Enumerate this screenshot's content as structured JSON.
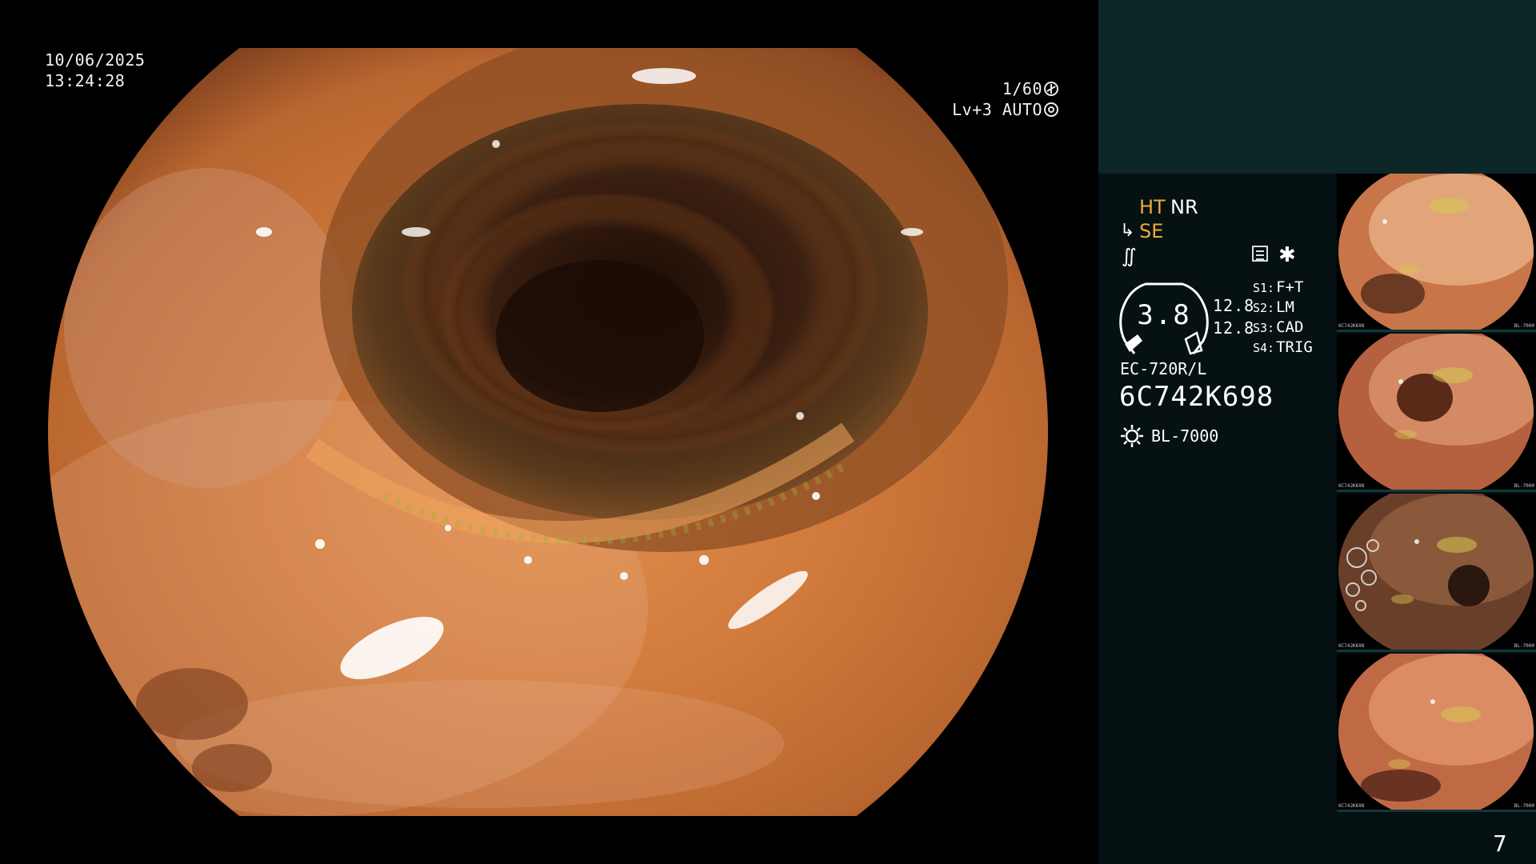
{
  "overlay": {
    "date": "10/06/2025",
    "time": "13:24:28",
    "shutter_speed": "1/60",
    "iris_level": "Lv+3 AUTO"
  },
  "modes": {
    "ht": "HT",
    "nr": "NR",
    "se": "SE"
  },
  "zoom": {
    "value": "3.8",
    "param_1": "12.8",
    "param_2": "12.8"
  },
  "switches": [
    {
      "key": "S1:",
      "value": "F+T"
    },
    {
      "key": "S2:",
      "value": "LM"
    },
    {
      "key": "S3:",
      "value": "CAD"
    },
    {
      "key": "S4:",
      "value": "TRIG"
    }
  ],
  "scope": {
    "model": "EC-720R/L",
    "serial": "6C742K698",
    "light_source": "BL-7000"
  },
  "thumbnails": [
    {
      "serial": "6C742K698",
      "light": "BL-7000",
      "palette": [
        "#f4c59a",
        "#c8754a",
        "#6b3a22"
      ]
    },
    {
      "serial": "6C742K698",
      "light": "BL-7000",
      "palette": [
        "#e9a67f",
        "#b5603f",
        "#5a2a18"
      ]
    },
    {
      "serial": "6C742K698",
      "light": "BL-7000",
      "palette": [
        "#a06a4a",
        "#6a3f2a",
        "#2a1810"
      ]
    },
    {
      "serial": "6C742K698",
      "light": "BL-7000",
      "palette": [
        "#eca37c",
        "#c06a45",
        "#6a3220"
      ]
    }
  ],
  "icons": {
    "shutter": "shutter-icon",
    "iris": "iris-icon",
    "structure_enhance": "se-icon",
    "memo": "memo-icon",
    "light": "light-icon"
  },
  "colors": {
    "active_mode": "#f0a838",
    "panel_top": "#0d2628",
    "panel": "#051113"
  },
  "page_number": "7"
}
